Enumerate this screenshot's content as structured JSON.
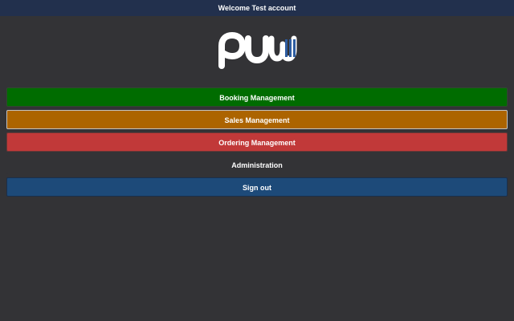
{
  "header": {
    "welcome_text": "Welcome Test account"
  },
  "logo": {
    "name": "PUW logo"
  },
  "menu": {
    "items": [
      {
        "label": "Booking Management",
        "color": "#006c00"
      },
      {
        "label": "Sales Management",
        "color": "#ac6400"
      },
      {
        "label": "Ordering Management",
        "color": "#c13939"
      },
      {
        "label": "Administration",
        "color": "#333336"
      },
      {
        "label": "Sign out",
        "color": "#1d4a79"
      }
    ]
  },
  "colors": {
    "background": "#333336",
    "header": "#22304d",
    "logo_accent": "#2d5ca0"
  }
}
